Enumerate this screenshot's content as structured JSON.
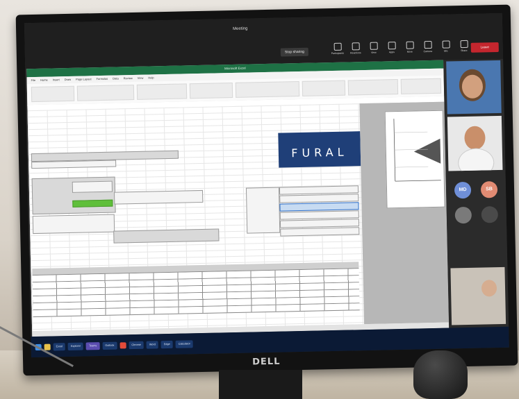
{
  "teams": {
    "meeting_title": "Meeting",
    "share_label": "Stop sharing",
    "tool_labels": [
      "Participants",
      "Reactions",
      "View",
      "Apps",
      "More",
      "Camera",
      "Mic",
      "Share"
    ],
    "leave_label": "Leave"
  },
  "excel": {
    "title": "Microsoft Excel",
    "ribbon_tabs": [
      "File",
      "Home",
      "Insert",
      "Draw",
      "Page Layout",
      "Formulas",
      "Data",
      "Review",
      "View",
      "Help"
    ]
  },
  "logo": {
    "text": "FURAL"
  },
  "taskbar": {
    "apps": [
      "Excel",
      "Explorer",
      "Teams",
      "Outlook",
      "Chrome",
      "Word",
      "Edge",
      "Calculator"
    ]
  },
  "colors": {
    "excel_green": "#1e7145",
    "logo_blue": "#1f3f78",
    "leave_red": "#c4262e",
    "taskbar_bg": "#0b1a35"
  }
}
